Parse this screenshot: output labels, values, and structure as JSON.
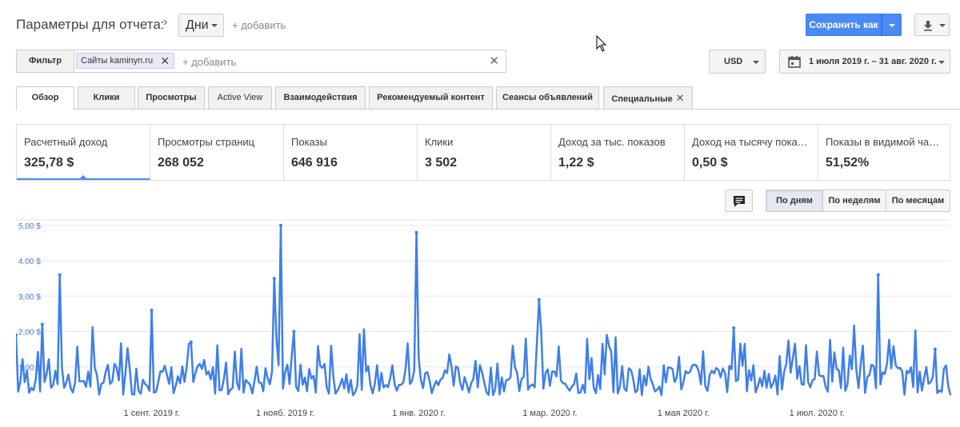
{
  "header": {
    "title": "Параметры для отчета:",
    "crumb_arrow": "›",
    "dimension_value": "Дни",
    "add_label": "+ добавить",
    "save_label": "Сохранить как"
  },
  "filter": {
    "button_label": "Фильтр",
    "chip_label": "Сайты kaminyn.ru",
    "chip_close": "✕",
    "add_label": "+ добавить",
    "clear": "✕"
  },
  "currency": {
    "value": "USD"
  },
  "date_range": {
    "value": "1 июля 2019 г. – 31 авг. 2020 г."
  },
  "tabs": [
    {
      "label": "Обзор"
    },
    {
      "label": "Клики"
    },
    {
      "label": "Просмотры"
    },
    {
      "label": "Active View"
    },
    {
      "label": "Взаимодействия"
    },
    {
      "label": "Рекомендуемый контент"
    },
    {
      "label": "Сеансы объявлений"
    },
    {
      "label": "Специальные"
    }
  ],
  "tab_close": "✕",
  "metrics": [
    {
      "label": "Расчетный доход",
      "value": "325,78 $"
    },
    {
      "label": "Просмотры страниц",
      "value": "268 052"
    },
    {
      "label": "Показы",
      "value": "646 916"
    },
    {
      "label": "Клики",
      "value": "3 502"
    },
    {
      "label": "Доход за тыс. показов",
      "value": "1,22 $"
    },
    {
      "label": "Доход на тысячу пока…",
      "value": "0,50 $"
    },
    {
      "label": "Показы в видимой ча…",
      "value": "51,52%"
    }
  ],
  "periods": [
    {
      "label": "По дням"
    },
    {
      "label": "По неделям"
    },
    {
      "label": "По месяцам"
    }
  ],
  "colors": {
    "accent": "#4a8af4",
    "line": "#3f7fe8",
    "grid": "#e6e6e6"
  },
  "chart_data": {
    "type": "line",
    "x_start": "2019-07-01",
    "x_end": "2020-08-31",
    "ylim": [
      0,
      5.2
    ],
    "yticks": [
      {
        "value": 5,
        "label": "5,00 $"
      },
      {
        "value": 4,
        "label": "4,00 $"
      },
      {
        "value": 3,
        "label": "3,00 $"
      },
      {
        "value": 2,
        "label": "2,00 $"
      },
      {
        "value": 1,
        "label": "1,00 $"
      }
    ],
    "xticks": [
      {
        "date": "2019-09-01",
        "label": "1 сент. 2019 г."
      },
      {
        "date": "2019-11-01",
        "label": "1 нояб. 2019 г."
      },
      {
        "date": "2020-01-01",
        "label": "1 янв. 2020 г."
      },
      {
        "date": "2020-03-01",
        "label": "1 мар. 2020 г."
      },
      {
        "date": "2020-05-01",
        "label": "1 мая 2020 г."
      },
      {
        "date": "2020-07-01",
        "label": "1 июл. 2020 г."
      }
    ],
    "series": [
      {
        "peaks": [
          {
            "date": "2019-07-01",
            "y": 1.9
          },
          {
            "date": "2019-07-13",
            "y": 2.2
          },
          {
            "date": "2019-07-21",
            "y": 3.6
          },
          {
            "date": "2019-09-01",
            "y": 2.6
          },
          {
            "date": "2019-09-19",
            "y": 1.7
          },
          {
            "date": "2019-10-27",
            "y": 3.5
          },
          {
            "date": "2019-10-30",
            "y": 5.0
          },
          {
            "date": "2019-11-05",
            "y": 2.0
          },
          {
            "date": "2019-12-31",
            "y": 4.8
          },
          {
            "date": "2020-02-25",
            "y": 2.9
          },
          {
            "date": "2020-05-24",
            "y": 2.1
          },
          {
            "date": "2020-07-29",
            "y": 3.6
          },
          {
            "date": "2020-08-24",
            "y": 1.5
          }
        ],
        "baseline": 0.6
      }
    ]
  }
}
